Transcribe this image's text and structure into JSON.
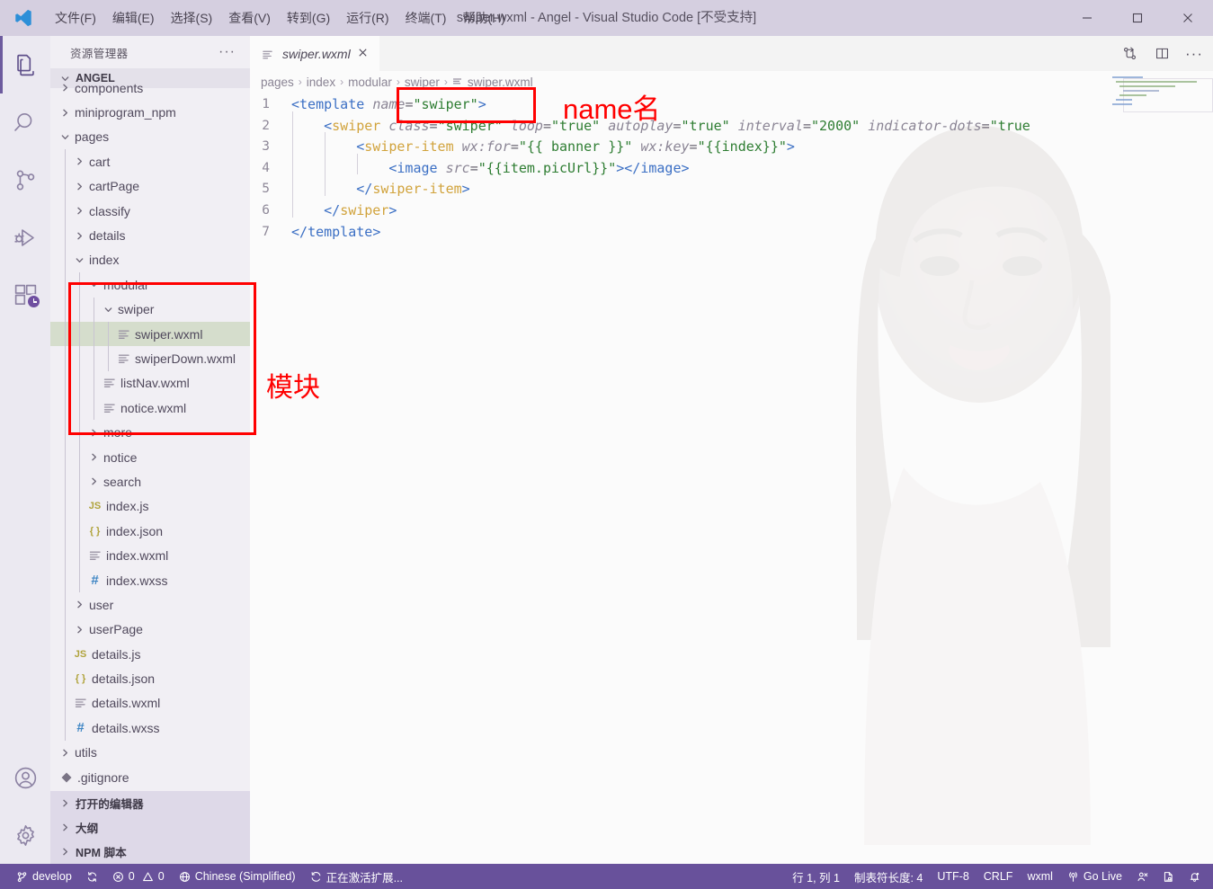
{
  "titlebar": {
    "logo_icon": "vscode-logo-icon",
    "menus": [
      {
        "label": "文件(F)"
      },
      {
        "label": "编辑(E)"
      },
      {
        "label": "选择(S)"
      },
      {
        "label": "查看(V)"
      },
      {
        "label": "转到(G)"
      },
      {
        "label": "运行(R)"
      },
      {
        "label": "终端(T)"
      },
      {
        "label": "帮助(H)"
      }
    ],
    "window_title": "swiper.wxml - Angel - Visual Studio Code [不受支持]",
    "controls": {
      "minimize_icon": "minimize-icon",
      "maximize_icon": "maximize-icon",
      "close_icon": "close-icon"
    }
  },
  "activitybar": {
    "items": [
      {
        "icon": "explorer-files-icon",
        "active": true
      },
      {
        "icon": "search-icon",
        "active": false
      },
      {
        "icon": "source-control-branch-icon",
        "active": false
      },
      {
        "icon": "run-and-debug-icon",
        "active": false
      },
      {
        "icon": "extensions-icon",
        "active": false,
        "badge": "clock-badge"
      }
    ],
    "bottom_items": [
      {
        "icon": "account-person-icon"
      },
      {
        "icon": "manage-gear-icon"
      }
    ]
  },
  "sidebar": {
    "title": "资源管理器",
    "more_icon": "ellipsis-icon",
    "root_label": "ANGEL",
    "root_twist_icon": "chevron-down-icon",
    "tree": [
      {
        "label": "components",
        "indent": 1,
        "type": "folder",
        "twist": "chevron-right",
        "clipped": true
      },
      {
        "label": "miniprogram_npm",
        "indent": 1,
        "type": "folder",
        "twist": "chevron-right"
      },
      {
        "label": "pages",
        "indent": 1,
        "type": "folder",
        "twist": "chevron-down"
      },
      {
        "label": "cart",
        "indent": 2,
        "type": "folder",
        "twist": "chevron-right"
      },
      {
        "label": "cartPage",
        "indent": 2,
        "type": "folder",
        "twist": "chevron-right"
      },
      {
        "label": "classify",
        "indent": 2,
        "type": "folder",
        "twist": "chevron-right"
      },
      {
        "label": "details",
        "indent": 2,
        "type": "folder",
        "twist": "chevron-right"
      },
      {
        "label": "index",
        "indent": 2,
        "type": "folder",
        "twist": "chevron-down"
      },
      {
        "label": "modular",
        "indent": 3,
        "type": "folder",
        "twist": "chevron-down"
      },
      {
        "label": "swiper",
        "indent": 4,
        "type": "folder",
        "twist": "chevron-down"
      },
      {
        "label": "swiper.wxml",
        "indent": 5,
        "type": "wxml",
        "selected": true
      },
      {
        "label": "swiperDown.wxml",
        "indent": 5,
        "type": "wxml"
      },
      {
        "label": "listNav.wxml",
        "indent": 4,
        "type": "wxml"
      },
      {
        "label": "notice.wxml",
        "indent": 4,
        "type": "wxml"
      },
      {
        "label": "more",
        "indent": 3,
        "type": "folder",
        "twist": "chevron-right"
      },
      {
        "label": "notice",
        "indent": 3,
        "type": "folder",
        "twist": "chevron-right"
      },
      {
        "label": "search",
        "indent": 3,
        "type": "folder",
        "twist": "chevron-right"
      },
      {
        "label": "index.js",
        "indent": 3,
        "type": "js"
      },
      {
        "label": "index.json",
        "indent": 3,
        "type": "json"
      },
      {
        "label": "index.wxml",
        "indent": 3,
        "type": "wxml"
      },
      {
        "label": "index.wxss",
        "indent": 3,
        "type": "wxss"
      },
      {
        "label": "user",
        "indent": 2,
        "type": "folder",
        "twist": "chevron-right"
      },
      {
        "label": "userPage",
        "indent": 2,
        "type": "folder",
        "twist": "chevron-right"
      },
      {
        "label": "details.js",
        "indent": 2,
        "type": "js"
      },
      {
        "label": "details.json",
        "indent": 2,
        "type": "json"
      },
      {
        "label": "details.wxml",
        "indent": 2,
        "type": "wxml"
      },
      {
        "label": "details.wxss",
        "indent": 2,
        "type": "wxss"
      },
      {
        "label": "utils",
        "indent": 1,
        "type": "folder",
        "twist": "chevron-right"
      },
      {
        "label": ".gitignore",
        "indent": 1,
        "type": "git",
        "clipped": true
      }
    ],
    "sections": [
      {
        "label": "打开的编辑器",
        "twist": "chevron-right"
      },
      {
        "label": "大纲",
        "twist": "chevron-right"
      },
      {
        "label": "NPM 脚本",
        "twist": "chevron-right"
      }
    ]
  },
  "editor": {
    "tab": {
      "label": "swiper.wxml",
      "icon": "wxml-file-icon",
      "close_icon": "close-icon"
    },
    "tab_actions": [
      {
        "icon": "open-preview-split-icon"
      },
      {
        "icon": "split-editor-right-icon"
      },
      {
        "icon": "more-actions-ellipsis-icon"
      }
    ],
    "breadcrumb": [
      "pages",
      "index",
      "modular",
      "swiper",
      "swiper.wxml"
    ],
    "breadcrumb_separator": "›",
    "line_numbers": [
      "1",
      "2",
      "3",
      "4",
      "5",
      "6",
      "7"
    ],
    "code_lines": [
      [
        {
          "t": "punc",
          "v": "<"
        },
        {
          "t": "tag",
          "v": "template"
        },
        {
          "t": "plain",
          "v": " "
        },
        {
          "t": "attr",
          "v": "name"
        },
        {
          "t": "eq",
          "v": "="
        },
        {
          "t": "str",
          "v": "\"swiper\""
        },
        {
          "t": "punc",
          "v": ">"
        }
      ],
      [
        {
          "t": "plain",
          "v": "    "
        },
        {
          "t": "punc",
          "v": "<"
        },
        {
          "t": "tag2",
          "v": "swiper"
        },
        {
          "t": "plain",
          "v": " "
        },
        {
          "t": "attr",
          "v": "class"
        },
        {
          "t": "eq",
          "v": "="
        },
        {
          "t": "str",
          "v": "\"swiper\""
        },
        {
          "t": "plain",
          "v": " "
        },
        {
          "t": "attr",
          "v": "loop"
        },
        {
          "t": "eq",
          "v": "="
        },
        {
          "t": "str",
          "v": "\"true\""
        },
        {
          "t": "plain",
          "v": " "
        },
        {
          "t": "attr",
          "v": "autoplay"
        },
        {
          "t": "eq",
          "v": "="
        },
        {
          "t": "str",
          "v": "\"true\""
        },
        {
          "t": "plain",
          "v": " "
        },
        {
          "t": "attr",
          "v": "interval"
        },
        {
          "t": "eq",
          "v": "="
        },
        {
          "t": "str",
          "v": "\"2000\""
        },
        {
          "t": "plain",
          "v": " "
        },
        {
          "t": "attr",
          "v": "indicator-dots"
        },
        {
          "t": "eq",
          "v": "="
        },
        {
          "t": "str",
          "v": "\"true"
        }
      ],
      [
        {
          "t": "plain",
          "v": "        "
        },
        {
          "t": "punc",
          "v": "<"
        },
        {
          "t": "tag2",
          "v": "swiper-item"
        },
        {
          "t": "plain",
          "v": " "
        },
        {
          "t": "attr",
          "v": "wx:for"
        },
        {
          "t": "eq",
          "v": "="
        },
        {
          "t": "str",
          "v": "\"{{ banner }}\""
        },
        {
          "t": "plain",
          "v": " "
        },
        {
          "t": "attr",
          "v": "wx:key"
        },
        {
          "t": "eq",
          "v": "="
        },
        {
          "t": "str",
          "v": "\"{{index}}\""
        },
        {
          "t": "punc",
          "v": ">"
        }
      ],
      [
        {
          "t": "plain",
          "v": "            "
        },
        {
          "t": "punc",
          "v": "<"
        },
        {
          "t": "tag",
          "v": "image"
        },
        {
          "t": "plain",
          "v": " "
        },
        {
          "t": "attr",
          "v": "src"
        },
        {
          "t": "eq",
          "v": "="
        },
        {
          "t": "str",
          "v": "\"{{item.picUrl}}\""
        },
        {
          "t": "punc",
          "v": ">"
        },
        {
          "t": "punc",
          "v": "</"
        },
        {
          "t": "tag",
          "v": "image"
        },
        {
          "t": "punc",
          "v": ">"
        }
      ],
      [
        {
          "t": "plain",
          "v": "        "
        },
        {
          "t": "punc",
          "v": "</"
        },
        {
          "t": "tag2",
          "v": "swiper-item"
        },
        {
          "t": "punc",
          "v": ">"
        }
      ],
      [
        {
          "t": "plain",
          "v": "    "
        },
        {
          "t": "punc",
          "v": "</"
        },
        {
          "t": "tag2",
          "v": "swiper"
        },
        {
          "t": "punc",
          "v": ">"
        }
      ],
      [
        {
          "t": "punc",
          "v": "</"
        },
        {
          "t": "tag",
          "v": "template"
        },
        {
          "t": "punc",
          "v": ">"
        }
      ]
    ]
  },
  "annotations": [
    {
      "id": "name-label",
      "text": "name名"
    },
    {
      "id": "module-label",
      "text": "模块"
    }
  ],
  "statusbar": {
    "left": [
      {
        "icon": "source-control-branch-icon",
        "label": "develop"
      },
      {
        "icon": "sync-refresh-icon",
        "label": ""
      },
      {
        "icon": "error-circle-icon",
        "label": "0",
        "icon2": "warning-triangle-icon",
        "label2": "0"
      },
      {
        "icon": "globe-icon",
        "label": "Chinese (Simplified)"
      },
      {
        "icon": "loading-spinner-icon",
        "label": "正在激活扩展..."
      }
    ],
    "right": [
      {
        "label": "行 1, 列 1"
      },
      {
        "label": "制表符长度: 4"
      },
      {
        "label": "UTF-8"
      },
      {
        "label": "CRLF"
      },
      {
        "label": "wxml"
      },
      {
        "icon": "broadcast-icon",
        "label": "Go Live"
      },
      {
        "icon": "live-share-icon",
        "label": ""
      },
      {
        "icon": "screencast-icon",
        "label": ""
      },
      {
        "icon": "bell-dot-icon",
        "label": ""
      }
    ]
  },
  "colors": {
    "titlebar_bg": "#d5cfe0",
    "statusbar_bg": "#68519b",
    "accent": "#6d5b9e",
    "annotation_red": "#ff0000",
    "selection_green": "#d5ddcc"
  }
}
